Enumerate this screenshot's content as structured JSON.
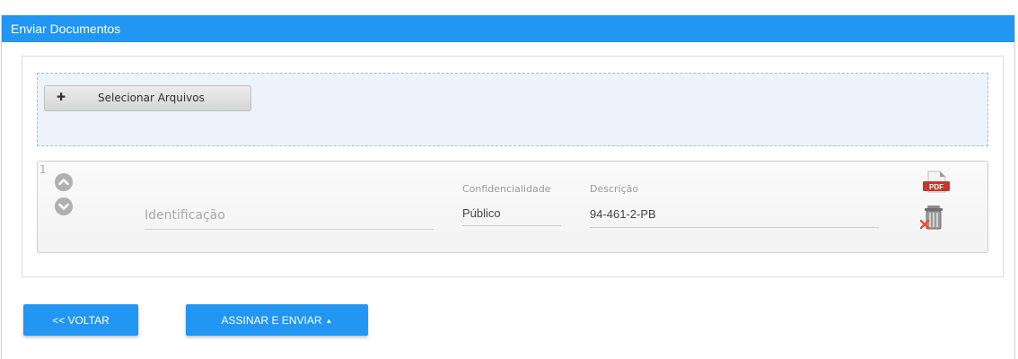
{
  "header": {
    "title": "Enviar Documentos"
  },
  "upload": {
    "select_label": "Selecionar Arquivos",
    "select_icon": "plus-icon"
  },
  "document": {
    "index": "1",
    "identification_placeholder": "Identificação",
    "identification_value": "",
    "confidentiality_label": "Confidencialidade",
    "confidentiality_value": "Público",
    "description_label": "Descrição",
    "description_value": "94-461-2-PB",
    "file_icon": "pdf-file-icon",
    "pdf_badge": "PDF",
    "delete_icon": "trash-delete-icon"
  },
  "actions": {
    "back_label": "<< VOLTAR",
    "sign_label": "ASSINAR E ENVIAR"
  },
  "colors": {
    "primary": "#2196f3",
    "dropzone_bg": "#edf3fb",
    "pdf_red": "#c0392b"
  }
}
